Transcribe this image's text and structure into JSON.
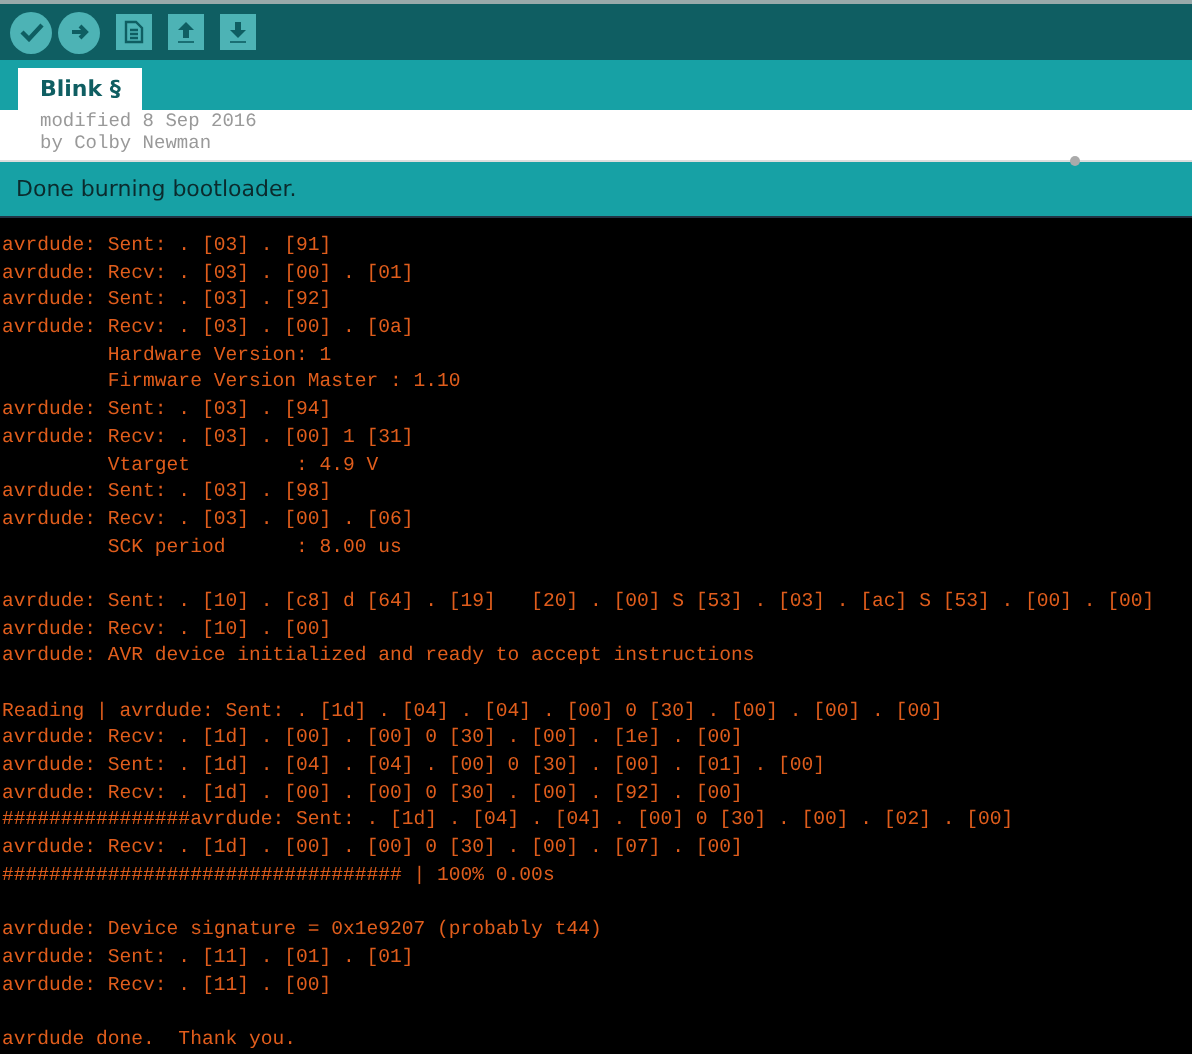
{
  "toolbar": {
    "buttons": [
      {
        "kind": "verify"
      },
      {
        "kind": "upload"
      },
      {
        "kind": "new"
      },
      {
        "kind": "open"
      },
      {
        "kind": "save"
      }
    ]
  },
  "tabs": [
    {
      "label": "Blink §",
      "selected": true
    }
  ],
  "editor": {
    "lines": [
      "modified 8 Sep 2016",
      "by Colby Newman"
    ]
  },
  "status_bar": {
    "message": "Done burning bootloader."
  },
  "console": {
    "paragraphs": [
      [
        "avrdude: Sent: . [03] . [91]",
        "avrdude: Recv: . [03] . [00] . [01]",
        "avrdude: Sent: . [03] . [92]",
        "avrdude: Recv: . [03] . [00] . [0a]",
        "         Hardware Version: 1",
        "         Firmware Version Master : 1.10",
        "avrdude: Sent: . [03] . [94]",
        "avrdude: Recv: . [03] . [00] 1 [31]",
        "         Vtarget         : 4.9 V",
        "avrdude: Sent: . [03] . [98]",
        "avrdude: Recv: . [03] . [00] . [06]",
        "         SCK period      : 8.00 us"
      ],
      [
        "avrdude: Sent: . [10] . [c8] d [64] . [19]   [20] . [00] S [53] . [03] . [ac] S [53] . [00] . [00]",
        "avrdude: Recv: . [10] . [00]",
        "avrdude: AVR device initialized and ready to accept instructions"
      ],
      [
        "Reading | avrdude: Sent: . [1d] . [04] . [04] . [00] 0 [30] . [00] . [00] . [00]",
        "avrdude: Recv: . [1d] . [00] . [00] 0 [30] . [00] . [1e] . [00]",
        "avrdude: Sent: . [1d] . [04] . [04] . [00] 0 [30] . [00] . [01] . [00]",
        "avrdude: Recv: . [1d] . [00] . [00] 0 [30] . [00] . [92] . [00]",
        "################avrdude: Sent: . [1d] . [04] . [04] . [00] 0 [30] . [00] . [02] . [00]",
        "avrdude: Recv: . [1d] . [00] . [00] 0 [30] . [00] . [07] . [00]",
        "################################## | 100% 0.00s"
      ],
      [
        "avrdude: Device signature = 0x1e9207 (probably t44)",
        "avrdude: Sent: . [11] . [01] . [01]",
        "avrdude: Recv: . [11] . [00]"
      ],
      [
        "avrdude done.  Thank you."
      ]
    ]
  }
}
